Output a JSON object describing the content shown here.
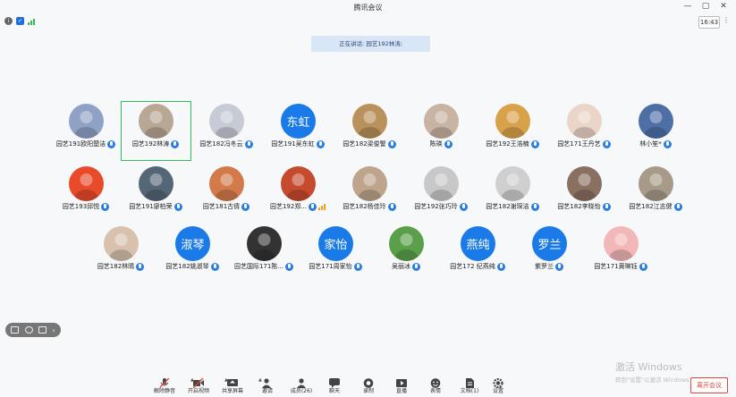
{
  "window": {
    "title": "腾讯会议",
    "clock": "16:43"
  },
  "speaking_banner": "正在讲话: 园艺192林涛;",
  "participants": [
    {
      "name": "园艺191欧阳楚洁",
      "avatar": "photo",
      "color": "#8fa2c6"
    },
    {
      "name": "园艺192林涛",
      "avatar": "photo",
      "color": "#b9a796",
      "selected": true
    },
    {
      "name": "园艺182冯冬云",
      "avatar": "photo",
      "color": "#c7cbd6"
    },
    {
      "name": "园艺191吴东虹",
      "avatar": "text",
      "avatar_text": "东虹"
    },
    {
      "name": "园艺182梁俊警",
      "avatar": "photo",
      "color": "#b9915a"
    },
    {
      "name": "陈瑛",
      "avatar": "photo",
      "color": "#c9b3a2"
    },
    {
      "name": "园艺192王浩楠",
      "avatar": "photo",
      "color": "#d9a24a"
    },
    {
      "name": "园艺171王丹艺",
      "avatar": "photo",
      "color": "#ebd5c8"
    },
    {
      "name": "林小笙*",
      "avatar": "photo",
      "color": "#4e6fa6"
    },
    {
      "name": "园艺193邱悦",
      "avatar": "photo",
      "color": "#e84a2a"
    },
    {
      "name": "园艺191廖柏荣",
      "avatar": "photo",
      "color": "#556677"
    },
    {
      "name": "园艺181古倩",
      "avatar": "photo",
      "color": "#d27a4a"
    },
    {
      "name": "园艺192郑...",
      "avatar": "photo",
      "color": "#c64a2e"
    },
    {
      "name": "园艺182杨佳玲",
      "avatar": "photo",
      "color": "#bda48a"
    },
    {
      "name": "园艺192张巧玲",
      "avatar": "photo",
      "color": "#c8c8c8"
    },
    {
      "name": "园艺182谢琛洁",
      "avatar": "photo",
      "color": "#cfcfcf"
    },
    {
      "name": "园艺182李晓怡",
      "avatar": "photo",
      "color": "#8a7060"
    },
    {
      "name": "园艺182江志健",
      "avatar": "photo",
      "color": "#a89a88"
    },
    {
      "name": "园艺182林晴",
      "avatar": "photo",
      "color": "#d8c2ae"
    },
    {
      "name": "园艺182姚淑琴",
      "avatar": "text",
      "avatar_text": "淑琴"
    },
    {
      "name": "园艺国际171陈...",
      "avatar": "photo",
      "color": "#333333"
    },
    {
      "name": "园艺171周家怡",
      "avatar": "text",
      "avatar_text": "家怡"
    },
    {
      "name": "吴丽冰",
      "avatar": "photo",
      "color": "#5aa04a"
    },
    {
      "name": "园艺172 纪燕纯",
      "avatar": "text",
      "avatar_text": "燕纯"
    },
    {
      "name": "紫罗兰",
      "avatar": "text",
      "avatar_text": "罗兰"
    },
    {
      "name": "园艺171黄琳钰",
      "avatar": "photo",
      "color": "#f2b8b8"
    }
  ],
  "toolbar": {
    "items": [
      {
        "label": "解除静音",
        "icon": "mic-muted-icon"
      },
      {
        "label": "开启视频",
        "icon": "camera-off-icon"
      },
      {
        "label": "共享屏幕",
        "icon": "screen-share-icon"
      },
      {
        "label": "邀请",
        "icon": "invite-icon"
      },
      {
        "label": "成员(26)",
        "icon": "members-icon"
      },
      {
        "label": "聊天",
        "icon": "chat-icon"
      },
      {
        "label": "录制",
        "icon": "record-icon"
      },
      {
        "label": "直播",
        "icon": "live-icon"
      },
      {
        "label": "表情",
        "icon": "emoji-icon"
      },
      {
        "label": "文档(1)",
        "icon": "document-icon"
      },
      {
        "label": "设置",
        "icon": "settings-icon"
      }
    ],
    "leave_label": "离开会议"
  },
  "watermark": {
    "line1": "激活 Windows",
    "line2": "转到\"设置\"以激活 Windows。"
  },
  "colors": {
    "accent": "#2a7de1",
    "selection": "#2fbf5a",
    "leave": "#e0463e"
  }
}
